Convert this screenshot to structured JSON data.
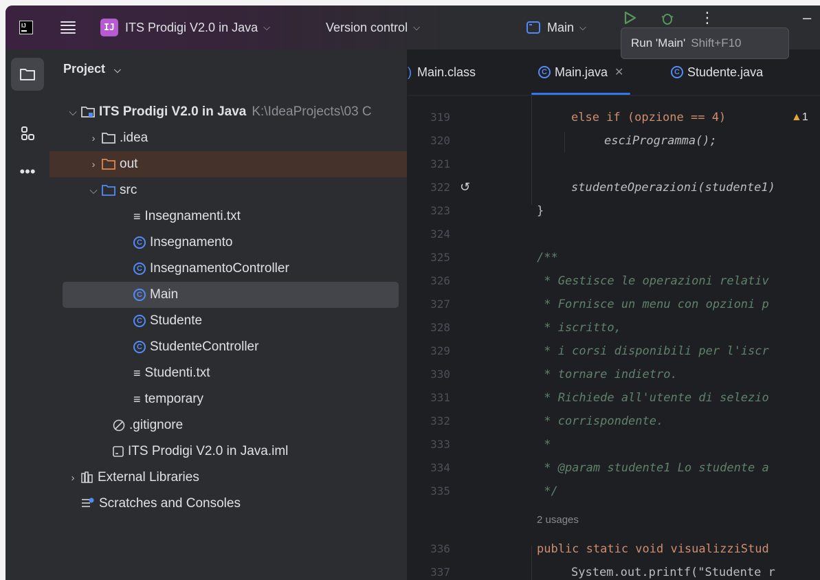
{
  "titlebar": {
    "project_badge": "IJ",
    "project_name": "ITS Prodigi V2.0 in Java",
    "version_control": "Version control",
    "run_config": "Main",
    "tooltip": {
      "text": "Run 'Main'",
      "shortcut": "Shift+F10"
    }
  },
  "project_panel": {
    "header": "Project",
    "tree": [
      {
        "label": "ITS Prodigi V2.0 in Java",
        "path": "K:\\IdeaProjects\\03 C",
        "type": "module"
      },
      {
        "label": ".idea",
        "type": "folder"
      },
      {
        "label": "out",
        "type": "folder"
      },
      {
        "label": "src",
        "type": "folder"
      },
      {
        "label": "Insegnamenti.txt",
        "type": "text"
      },
      {
        "label": "Insegnamento",
        "type": "class"
      },
      {
        "label": "InsegnamentoController",
        "type": "class"
      },
      {
        "label": "Main",
        "type": "class"
      },
      {
        "label": "Studente",
        "type": "class"
      },
      {
        "label": "StudenteController",
        "type": "class"
      },
      {
        "label": "Studenti.txt",
        "type": "text"
      },
      {
        "label": "temporary",
        "type": "text"
      },
      {
        "label": ".gitignore",
        "type": "ignore"
      },
      {
        "label": "ITS Prodigi V2.0 in Java.iml",
        "type": "iml"
      },
      {
        "label": "External Libraries",
        "type": "libraries"
      },
      {
        "label": "Scratches and Consoles",
        "type": "scratches"
      }
    ]
  },
  "editor": {
    "tabs": [
      {
        "label": "Main.class",
        "active": false
      },
      {
        "label": "Main.java",
        "active": true
      },
      {
        "label": "Studente.java",
        "active": false
      }
    ],
    "warning_count": "1",
    "usages": "2 usages",
    "lines": [
      {
        "num": "319",
        "code": "else if (opzione == 4)"
      },
      {
        "num": "320",
        "code": "esciProgramma();"
      },
      {
        "num": "321",
        "code": ""
      },
      {
        "num": "322",
        "code": "studenteOperazioni(studente1)"
      },
      {
        "num": "323",
        "code": "}"
      },
      {
        "num": "324",
        "code": ""
      },
      {
        "num": "325",
        "code": "/**"
      },
      {
        "num": "326",
        "code": " * Gestisce le operazioni relativ"
      },
      {
        "num": "327",
        "code": " * Fornisce un menu con opzioni p"
      },
      {
        "num": "328",
        "code": " * iscritto,"
      },
      {
        "num": "329",
        "code": " * i corsi disponibili per l'iscr"
      },
      {
        "num": "330",
        "code": " * tornare indietro."
      },
      {
        "num": "331",
        "code": " * Richiede all'utente di selezio"
      },
      {
        "num": "332",
        "code": " * corrispondente."
      },
      {
        "num": "333",
        "code": " *"
      },
      {
        "num": "334",
        "code": " * @param studente1 Lo studente a"
      },
      {
        "num": "335",
        "code": " */"
      },
      {
        "num": "336",
        "code": "public static void visualizziStud"
      },
      {
        "num": "337",
        "code": "System.out.printf(\"Studente r"
      }
    ]
  }
}
